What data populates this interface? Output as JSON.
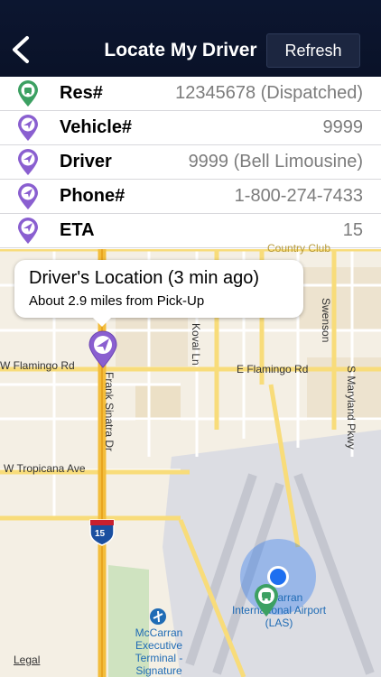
{
  "header": {
    "title": "Locate My Driver",
    "refresh_label": "Refresh"
  },
  "rows": [
    {
      "label": "Res#",
      "value": "12345678 (Dispatched)",
      "icon": "car-pin-icon"
    },
    {
      "label": "Vehicle#",
      "value": "9999",
      "icon": "location-arrow-pin-icon"
    },
    {
      "label": "Driver",
      "value": "9999 (Bell Limousine)",
      "icon": "location-arrow-pin-icon"
    },
    {
      "label": "Phone#",
      "value": "1-800-274-7433",
      "icon": "location-arrow-pin-icon"
    },
    {
      "label": "ETA",
      "value": "15",
      "icon": "location-arrow-pin-icon"
    }
  ],
  "callout": {
    "title": "Driver's Location (3 min ago)",
    "subtitle": "About 2.9 miles from Pick-Up"
  },
  "map": {
    "streets": {
      "w_flamingo": "W Flamingo Rd",
      "e_flamingo": "E Flamingo Rd",
      "frank_sinatra": "Frank Sinatra Dr",
      "koval": "Koval Ln",
      "swenson": "Swenson",
      "maryland": "S Maryland Pkwy",
      "tropicana": "W Tropicana Ave",
      "country_club": "Country Club"
    },
    "interstate": "15",
    "airport": "McCarran International Airport (LAS)",
    "terminal": "McCarran Executive Terminal - Signature",
    "legal": "Legal"
  },
  "colors": {
    "header_bg": "#0c1630",
    "pin_purple": "#8a5fd0",
    "pin_green": "#3ca062",
    "user_location_blue": "#1e6ff0"
  }
}
